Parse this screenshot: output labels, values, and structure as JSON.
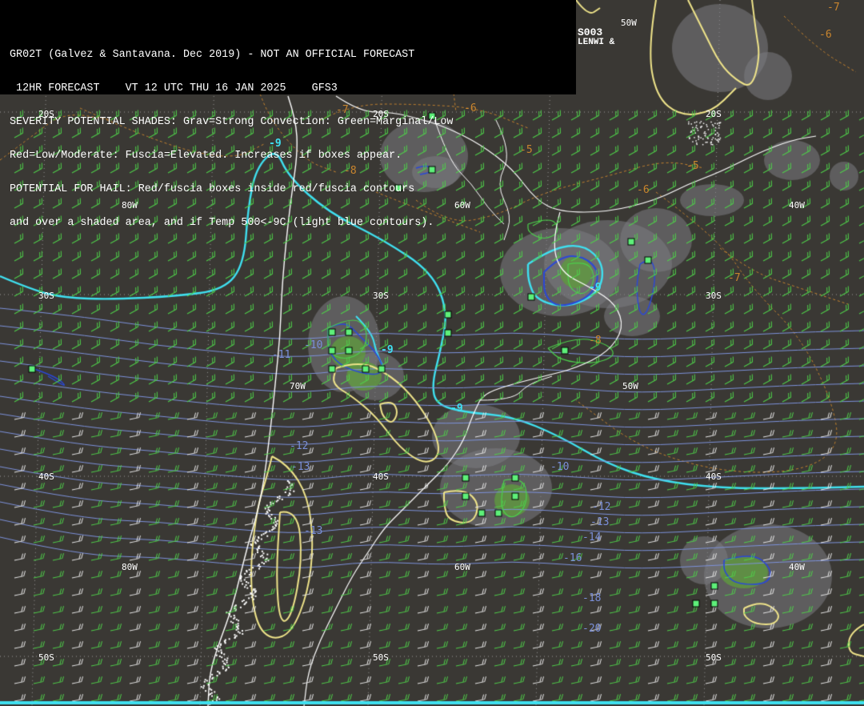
{
  "header": {
    "line1": "GR02T (Galvez & Santavana. Dec 2019) - NOT AN OFFICIAL FORECAST",
    "line2": " 12HR FORECAST    VT 12 UTC THU 16 JAN 2025    GFS3",
    "line3": "SEVERITY POTENTIAL SHADES: Grav=Strong Convection: Green=Marginal/Low",
    "line4": "Red=Low/Moderate: Fuscia=Elevated. Increases if boxes appear.",
    "line5": "POTENTIAL FOR HAIL: Red/fuscia boxes inside red/fuscia contours",
    "line6": "and over a shaded area, and if Temp 500<-9C (light blue contours)."
  },
  "corner_text": {
    "line1": "S003",
    "line2": "LENWI &"
  },
  "grid_labels": [
    {
      "text": "20S",
      "id": "lat-20s-a"
    },
    {
      "text": "30S",
      "id": "lat-30s-a"
    },
    {
      "text": "20S",
      "id": "lat-20s-b"
    },
    {
      "text": "20S",
      "id": "lat-20s-c"
    },
    {
      "text": "80W",
      "id": "lon-80w-a"
    },
    {
      "text": "60W",
      "id": "lon-60w-a"
    },
    {
      "text": "40W",
      "id": "lon-40w-a"
    },
    {
      "text": "50W",
      "id": "lon-50w-top"
    },
    {
      "text": "30S",
      "id": "lat-30s-b"
    },
    {
      "text": "30S",
      "id": "lat-30s-c"
    },
    {
      "text": "70W",
      "id": "lon-70w"
    },
    {
      "text": "50W",
      "id": "lon-50w-mid"
    },
    {
      "text": "40S",
      "id": "lat-40s-a"
    },
    {
      "text": "40S",
      "id": "lat-40s-b"
    },
    {
      "text": "40S",
      "id": "lat-40s-c"
    },
    {
      "text": "80W",
      "id": "lon-80w-b"
    },
    {
      "text": "60W",
      "id": "lon-60w-b"
    },
    {
      "text": "40W",
      "id": "lon-40w-b"
    },
    {
      "text": "50S",
      "id": "lat-50s-a"
    },
    {
      "text": "50S",
      "id": "lat-50s-b"
    },
    {
      "text": "50S",
      "id": "lat-50s-c"
    }
  ],
  "contour_labels": {
    "cyan": [
      "-9",
      "-9",
      "-9",
      "-9"
    ],
    "orange": [
      "-7",
      "-6",
      "-5",
      "-5",
      "-6",
      "-7",
      "-8",
      "-8",
      "-6",
      "-7"
    ],
    "blue": [
      "-10",
      "-11",
      "-12",
      "-13",
      "-10",
      "-12",
      "-13",
      "-14",
      "-16",
      "-18",
      "-20",
      "-13"
    ]
  },
  "colors": {
    "background": "#3a3834",
    "header_bg": "#000000",
    "coast": "#ffffff",
    "temp_cyan": "#3fe0f0",
    "temp_blue": "#7d92dc",
    "temp_orange": "#c9852e",
    "severity_gray": "#7c7c82",
    "severity_green": "#5f9a3e",
    "hail_box": "#5ef07a",
    "yellow_contour": "#efe48a",
    "wind_barb": "#4fd04a",
    "wind_barb_strong": "#e8e8e8"
  }
}
